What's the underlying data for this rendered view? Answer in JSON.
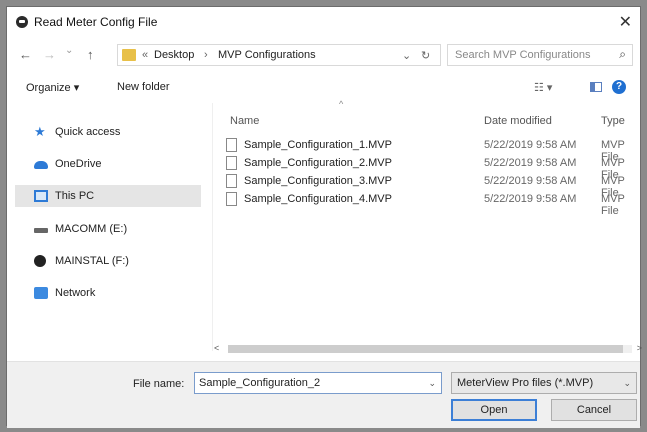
{
  "window": {
    "title": "Read Meter Config File",
    "close": "✕"
  },
  "nav": {
    "back": "←",
    "forward": "→",
    "recent": "⌄",
    "up": "↑",
    "breadcrumb": {
      "prefix": "«",
      "parts": [
        "Desktop",
        "MVP Configurations"
      ],
      "separator": "›"
    },
    "dropdown": "⌄",
    "refresh": "↻",
    "search_placeholder": "Search MVP Configurations",
    "search_icon": "⌕"
  },
  "toolbar": {
    "organize": "Organize ▾",
    "new_folder": "New folder",
    "view_icon": "☷ ▾",
    "help": "?"
  },
  "sidebar": {
    "items": [
      {
        "label": "Quick access",
        "icon": "star-icon"
      },
      {
        "label": "OneDrive",
        "icon": "cloud-icon"
      },
      {
        "label": "This PC",
        "icon": "computer-icon",
        "selected": true
      },
      {
        "label": "MACOMM (E:)",
        "icon": "drive-icon"
      },
      {
        "label": "MAINSTAL (F:)",
        "icon": "disc-icon"
      },
      {
        "label": "Network",
        "icon": "network-icon"
      }
    ]
  },
  "columns": {
    "name": "Name",
    "date": "Date modified",
    "type": "Type",
    "sort_caret": "^"
  },
  "files": [
    {
      "name": "Sample_Configuration_1.MVP",
      "date": "5/22/2019 9:58 AM",
      "type": "MVP File"
    },
    {
      "name": "Sample_Configuration_2.MVP",
      "date": "5/22/2019 9:58 AM",
      "type": "MVP File"
    },
    {
      "name": "Sample_Configuration_3.MVP",
      "date": "5/22/2019 9:58 AM",
      "type": "MVP File"
    },
    {
      "name": "Sample_Configuration_4.MVP",
      "date": "5/22/2019 9:58 AM",
      "type": "MVP File"
    }
  ],
  "scroll": {
    "left": "<",
    "right": ">"
  },
  "footer": {
    "file_name_label": "File name:",
    "file_name_value": "Sample_Configuration_2",
    "filter": "MeterView Pro files (*.MVP)",
    "open": "Open",
    "cancel": "Cancel",
    "dropdown": "⌄"
  },
  "colors": {
    "accent": "#3c7fd6",
    "folder": "#e8c048",
    "selected": "#e5e5e5"
  }
}
